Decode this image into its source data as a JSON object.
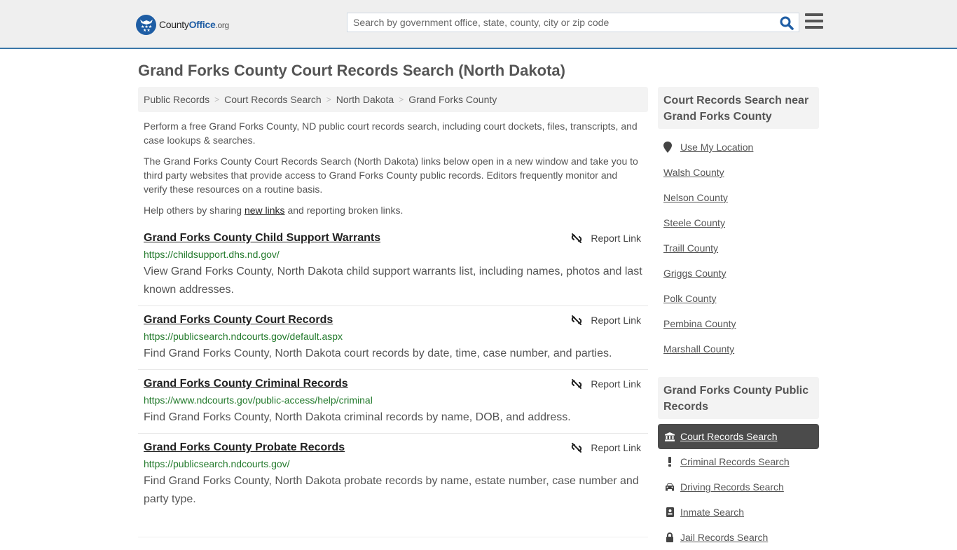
{
  "header": {
    "logo": {
      "text_main": "County",
      "text_accent": "Office",
      "text_tld": ".org"
    },
    "search": {
      "placeholder": "Search by government office, state, county, city or zip code",
      "value": ""
    },
    "colors": {
      "brand_blue": "#1e5da4",
      "header_bg": "#efefef",
      "header_border": "#3a77a8"
    }
  },
  "page": {
    "title": "Grand Forks County Court Records Search (North Dakota)",
    "breadcrumb": [
      "Public Records",
      "Court Records Search",
      "North Dakota",
      "Grand Forks County"
    ],
    "intro": {
      "p1": "Perform a free Grand Forks County, ND public court records search, including court dockets, files, transcripts, and case lookups & searches.",
      "p2": "The Grand Forks County Court Records Search (North Dakota) links below open in a new window and take you to third party websites that provide access to Grand Forks County public records. Editors frequently monitor and verify these resources on a routine basis.",
      "p3_before": "Help others by sharing ",
      "p3_link": "new links",
      "p3_after": " and reporting broken links."
    },
    "results": [
      {
        "title": "Grand Forks County Child Support Warrants",
        "url": "https://childsupport.dhs.nd.gov/",
        "description": "View Grand Forks County, North Dakota child support warrants list, including names, photos and last known addresses.",
        "report_label": "Report Link"
      },
      {
        "title": "Grand Forks County Court Records",
        "url": "https://publicsearch.ndcourts.gov/default.aspx",
        "description": "Find Grand Forks County, North Dakota court records by date, time, case number, and parties.",
        "report_label": "Report Link"
      },
      {
        "title": "Grand Forks County Criminal Records",
        "url": "https://www.ndcourts.gov/public-access/help/criminal",
        "description": "Find Grand Forks County, North Dakota criminal records by name, DOB, and address.",
        "report_label": "Report Link"
      },
      {
        "title": "Grand Forks County Probate Records",
        "url": "https://publicsearch.ndcourts.gov/",
        "description": "Find Grand Forks County, North Dakota probate records by name, estate number, case number and party type.",
        "report_label": "Report Link"
      }
    ]
  },
  "sidebar": {
    "nearby": {
      "heading": "Court Records Search near Grand Forks County",
      "use_location": "Use My Location",
      "counties": [
        "Walsh County",
        "Nelson County",
        "Steele County",
        "Traill County",
        "Griggs County",
        "Polk County",
        "Pembina County",
        "Marshall County"
      ]
    },
    "public_records": {
      "heading": "Grand Forks County Public Records",
      "items": [
        {
          "label": "Court Records Search",
          "icon": "courthouse-icon",
          "active": true
        },
        {
          "label": "Criminal Records Search",
          "icon": "exclamation-icon",
          "active": false
        },
        {
          "label": "Driving Records Search",
          "icon": "car-icon",
          "active": false
        },
        {
          "label": "Inmate Search",
          "icon": "id-badge-icon",
          "active": false
        },
        {
          "label": "Jail Records Search",
          "icon": "lock-icon",
          "active": false
        }
      ]
    }
  }
}
